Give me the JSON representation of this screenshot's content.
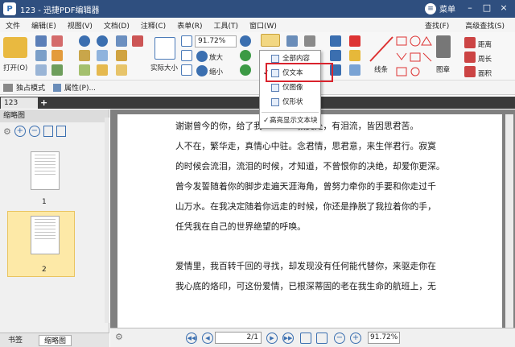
{
  "app": {
    "title": "123 - 迅捷PDF编辑器",
    "menu_label": "菜单"
  },
  "menubar": {
    "items": [
      "文件",
      "编辑(E)",
      "视图(V)",
      "文档(D)",
      "注释(C)",
      "表单(R)",
      "工具(T)",
      "窗口(W)"
    ],
    "find_label": "查找(F)",
    "advanced_find_label": "高级查找(S)"
  },
  "ribbon": {
    "open_label": "打开(O)",
    "actual_size_label": "实际大小",
    "zoom_value": "91.72%",
    "zoom_in_label": "放大",
    "zoom_out_label": "缩小",
    "line_label": "线条",
    "stamp_label": "图章",
    "distance_label": "距离",
    "perimeter_label": "周长",
    "area_label": "面积"
  },
  "subbar": {
    "exclusive_mode_label": "独占模式",
    "properties_label": "属性(P)..."
  },
  "tabs": {
    "document_tab": "123",
    "add_tab": "+"
  },
  "sidebar": {
    "header": "缩略图",
    "pages": [
      "1",
      "2"
    ],
    "bottom_tabs": [
      "书签",
      "缩略图"
    ]
  },
  "dropdown": {
    "items": [
      {
        "label": "全部内容",
        "checked": false
      },
      {
        "label": "仅文本",
        "checked": true
      },
      {
        "label": "仅图像",
        "checked": false
      },
      {
        "label": "仅形状",
        "checked": false
      }
    ],
    "highlight_label": "高亮显示文本块",
    "highlight_checked": true
  },
  "document": {
    "lines": [
      "谢谢曾今的你，给了我",
      "人不在，繁华走，真情心中驻。念君情，思君意，来生伴君行。寂寞",
      "的时候会流泪，流泪的时候，才知道，不曾恨你的决绝，却爱你更深。",
      "曾今发誓随着你的脚步走遍天涯海角，曾努力牵你的手要和你走过千",
      "山万水。在我决定随着你远走的时候，你还是挣脱了我拉着你的手，",
      "任凭我在自己的世界绝望的呼唤。",
      "爱情里，我百转千回的寻找，却发现没有任何能代替你，来驱走你在",
      "我心底的烙印，可这份爱情，已根深蒂固的老在我生命的航班上，无"
    ],
    "line1_tail": "寂寞处，有泪流，皆因思君苦。"
  },
  "statusbar": {
    "page_value": "2/1",
    "zoom_value": "91.72%"
  }
}
